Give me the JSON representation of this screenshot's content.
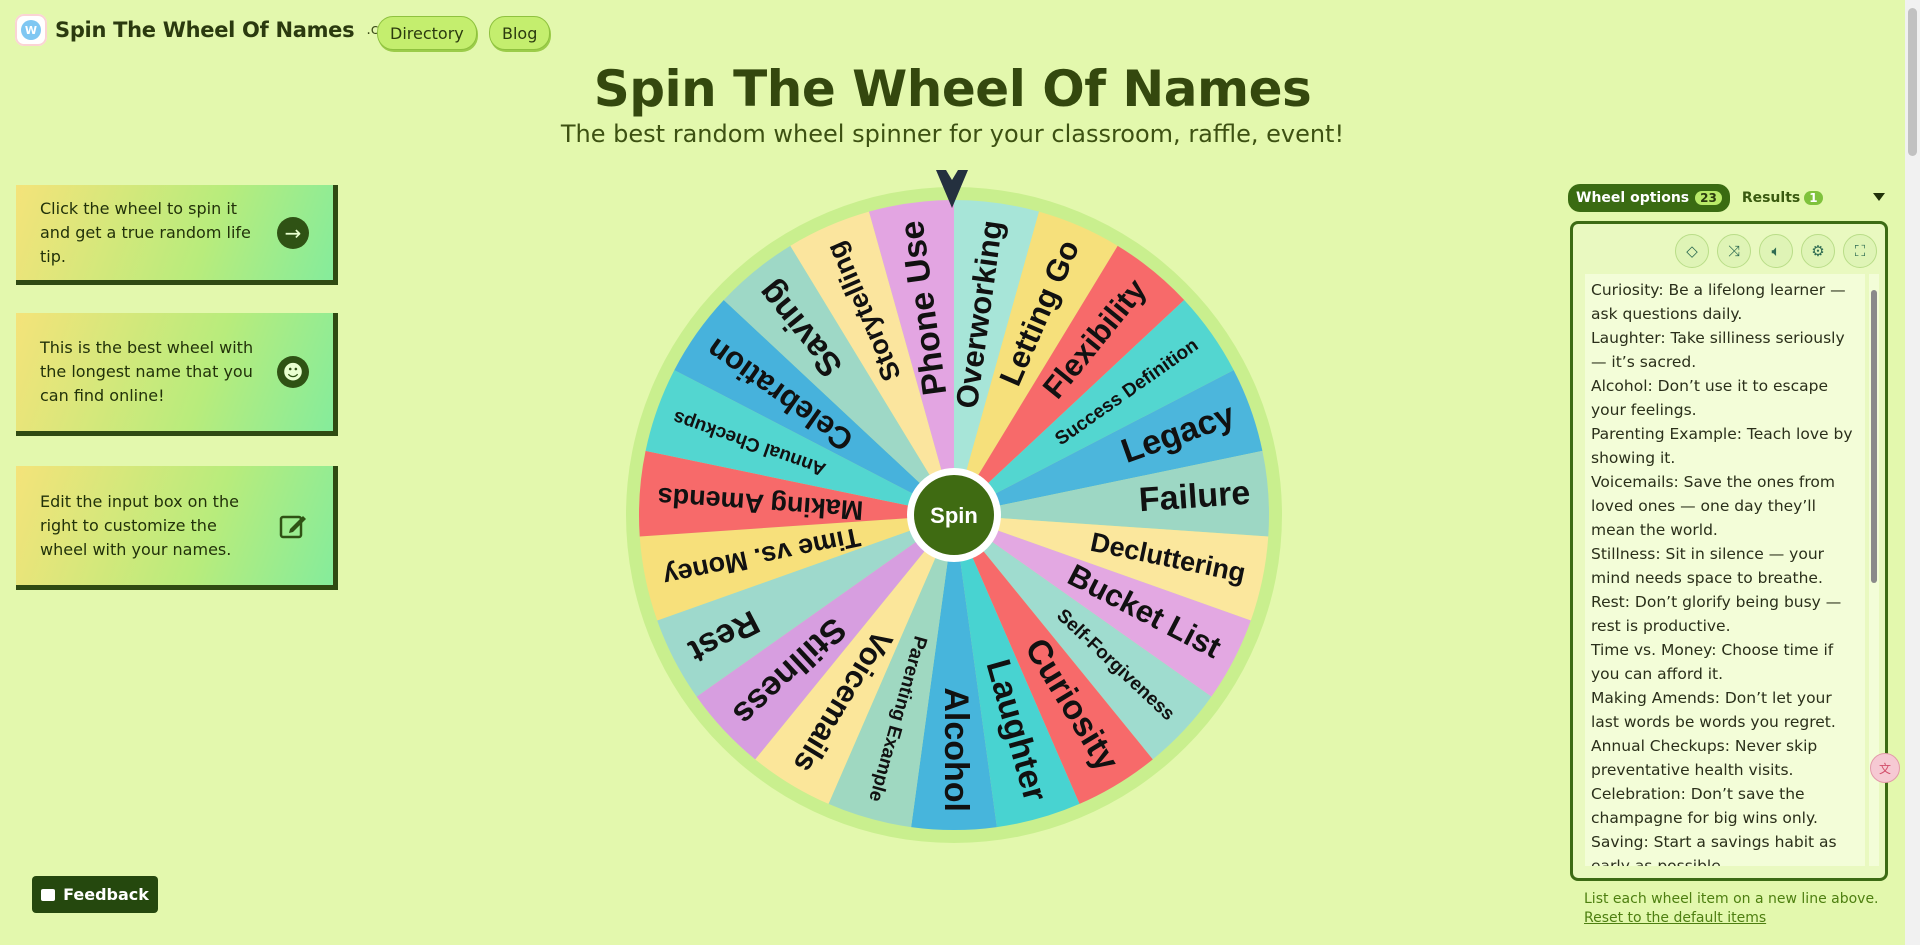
{
  "header": {
    "logo_text": "Spin The Wheel Of Names",
    "logo_suffix": ".com",
    "logo_icon": "butterfly-logo-icon",
    "nav": [
      "Directory",
      "Blog"
    ]
  },
  "hero": {
    "title": "Spin The Wheel Of Names",
    "subtitle": "The best random wheel spinner for your classroom, raffle, event!"
  },
  "tips": [
    {
      "text": "Click the wheel to spin it and get a true random life tip.",
      "icon": "arrow-right-icon"
    },
    {
      "text": "This is the best wheel with the longest name that you can find online!",
      "icon": "smiley-icon"
    },
    {
      "text": "Edit the input box on the right to customize the wheel with your names.",
      "icon": "edit-icon"
    }
  ],
  "wheel": {
    "center_label": "Spin",
    "rim_color": "#c9ef8e",
    "hub_color": "#3f6b12",
    "segments": [
      {
        "label": "Overworking",
        "color": "#a7e5d8"
      },
      {
        "label": "Letting Go",
        "color": "#f6e07b"
      },
      {
        "label": "Flexibility",
        "color": "#f76a6a"
      },
      {
        "label": "Success Definition",
        "color": "#53d6d0"
      },
      {
        "label": "Legacy",
        "color": "#4cb6dc"
      },
      {
        "label": "Failure",
        "color": "#9dd7c4"
      },
      {
        "label": "Decluttering",
        "color": "#fbe79d"
      },
      {
        "label": "Bucket List",
        "color": "#e3a8e2"
      },
      {
        "label": "Self-Forgiveness",
        "color": "#9fdccf"
      },
      {
        "label": "Curiosity",
        "color": "#f76a6a"
      },
      {
        "label": "Laughter",
        "color": "#48d3d1"
      },
      {
        "label": "Alcohol",
        "color": "#47b5dc"
      },
      {
        "label": "Parenting Example",
        "color": "#9fd8c1"
      },
      {
        "label": "Voicemails",
        "color": "#fbe69a"
      },
      {
        "label": "Stillness",
        "color": "#d79ee0"
      },
      {
        "label": "Rest",
        "color": "#9ed9cc"
      },
      {
        "label": "Time vs. Money",
        "color": "#f7e07b"
      },
      {
        "label": "Making Amends",
        "color": "#f76a6a"
      },
      {
        "label": "Annual Checkups",
        "color": "#53d6d0"
      },
      {
        "label": "Celebration",
        "color": "#47b2dc"
      },
      {
        "label": "Saving",
        "color": "#9ed8c6"
      },
      {
        "label": "Storytelling",
        "color": "#fbe59e"
      },
      {
        "label": "Phone Use",
        "color": "#e3a5e2"
      }
    ]
  },
  "panel": {
    "tab_options": "Wheel options",
    "tab_options_count": "23",
    "tab_results": "Results",
    "tab_results_count": "1",
    "tools": [
      "eraser-icon",
      "shuffle-icon",
      "volume-icon",
      "settings-icon",
      "fullscreen-icon"
    ],
    "items": [
      "Curiosity: Be a lifelong learner — ask questions daily.",
      "Laughter: Take silliness seriously — it’s sacred.",
      "Alcohol: Don’t use it to escape your feelings.",
      "Parenting Example: Teach love by showing it.",
      "Voicemails: Save the ones from loved ones — one day they’ll mean the world.",
      "Stillness: Sit in silence — your mind needs space to breathe.",
      "Rest: Don’t glorify being busy — rest is productive.",
      "Time vs. Money: Choose time if you can afford it.",
      "Making Amends: Don’t let your last words be words you regret.",
      "Annual Checkups: Never skip preventative health visits.",
      "Celebration: Don’t save the champagne for big wins only.",
      "Saving: Start a savings habit as early as possible."
    ],
    "hint": "List each wheel item on a new line above.",
    "reset": "Reset to the default items"
  },
  "feedback_label": "Feedback"
}
